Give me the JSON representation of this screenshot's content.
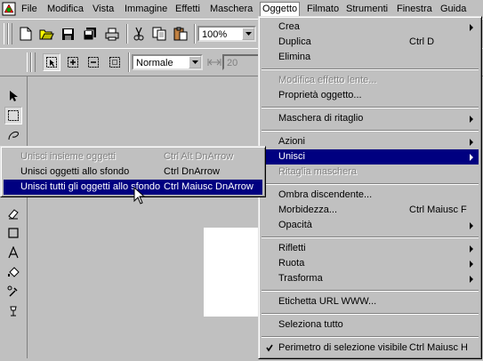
{
  "menubar": {
    "items": [
      "File",
      "Modifica",
      "Vista",
      "Immagine",
      "Effetti",
      "Maschera",
      "Oggetto",
      "Filmato",
      "Strumenti",
      "Finestra",
      "Guida"
    ],
    "active": "Oggetto"
  },
  "toolbar": {
    "zoom_value": "100%",
    "mode_value": "Normale",
    "size_value": "20"
  },
  "oggetto_menu": {
    "items": [
      {
        "label": "Crea",
        "shortcut": "",
        "submenu": true
      },
      {
        "label": "Duplica",
        "shortcut": "Ctrl D"
      },
      {
        "label": "Elimina",
        "shortcut": ""
      },
      {
        "label": "Modifica effetto lente...",
        "shortcut": "",
        "disabled": true
      },
      {
        "label": "Proprietà oggetto...",
        "shortcut": ""
      },
      {
        "label": "Maschera di ritaglio",
        "shortcut": "",
        "submenu": true
      },
      {
        "label": "Azioni",
        "shortcut": "",
        "submenu": true
      },
      {
        "label": "Unisci",
        "shortcut": "",
        "submenu": true,
        "selected": true
      },
      {
        "label": "Ritaglia maschera",
        "shortcut": "",
        "disabled": true
      },
      {
        "label": "Ombra discendente...",
        "shortcut": ""
      },
      {
        "label": "Morbidezza...",
        "shortcut": "Ctrl Maiusc F"
      },
      {
        "label": "Opacità",
        "shortcut": "",
        "submenu": true
      },
      {
        "label": "Rifletti",
        "shortcut": "",
        "submenu": true
      },
      {
        "label": "Ruota",
        "shortcut": "",
        "submenu": true
      },
      {
        "label": "Trasforma",
        "shortcut": "",
        "submenu": true
      },
      {
        "label": "Etichetta URL WWW...",
        "shortcut": ""
      },
      {
        "label": "Seleziona tutto",
        "shortcut": ""
      },
      {
        "label": "Perimetro di selezione visibile",
        "shortcut": "Ctrl Maiusc H",
        "checked": true
      }
    ]
  },
  "unisci_submenu": {
    "items": [
      {
        "label": "Unisci insieme oggetti",
        "shortcut": "Ctrl Alt DnArrow",
        "disabled": true
      },
      {
        "label": "Unisci oggetti allo sfondo",
        "shortcut": "Ctrl DnArrow"
      },
      {
        "label": "Unisci tutti gli oggetti allo sfondo",
        "shortcut": "Ctrl Maiusc DnArrow",
        "selected": true
      }
    ]
  },
  "colors": {
    "highlight": "#000080",
    "face": "#c0c0c0"
  }
}
